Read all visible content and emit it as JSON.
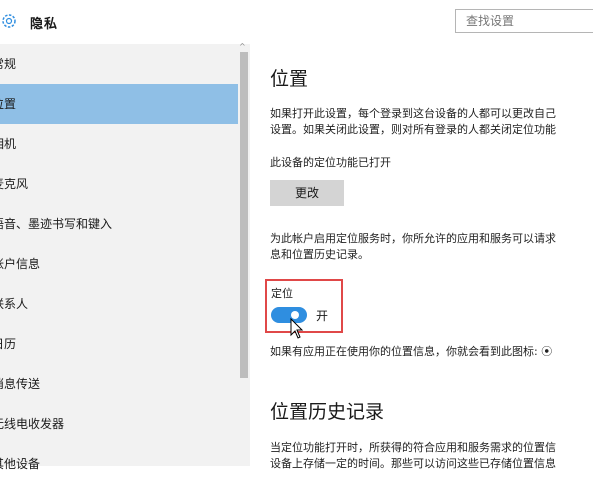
{
  "header": {
    "title": "隐私",
    "search_placeholder": "查找设置"
  },
  "sidebar": {
    "items": [
      {
        "label": "常规"
      },
      {
        "label": "位置"
      },
      {
        "label": "相机"
      },
      {
        "label": "麦克风"
      },
      {
        "label": "语音、墨迹书写和键入"
      },
      {
        "label": "帐户信息"
      },
      {
        "label": "联系人"
      },
      {
        "label": "日历"
      },
      {
        "label": "消息传送"
      },
      {
        "label": "无线电收发器"
      },
      {
        "label": "其他设备"
      }
    ],
    "selected": "位置"
  },
  "main": {
    "title": "位置",
    "intro_line1": "如果打开此设置，每个登录到这台设备的人都可以更改自己",
    "intro_line2": "设置。如果关闭此设置，则对所有登录的人都关闭定位功能",
    "device_status": "此设备的定位功能已打开",
    "change_button": "更改",
    "account_line1": "为此帐户启用定位服务时，你所允许的应用和服务可以请求",
    "account_line2": "息和位置历史记录。",
    "toggle_label": "定位",
    "toggle_state": "开",
    "toggle_on": true,
    "usage_note": "如果有应用正在使用你的位置信息，你就会看到此图标: ⦿",
    "history_title": "位置历史记录",
    "history_line1": "当定位功能打开时，所获得的符合应用和服务需求的位置信",
    "history_line2": "设备上存储一定的时间。那些可以访问这些已存储位置信息"
  },
  "colors": {
    "accent": "#2f8ee0",
    "selected_bg": "#8fbfe6",
    "highlight_border": "#e04848",
    "sidebar_bg": "#f2f2f2"
  }
}
